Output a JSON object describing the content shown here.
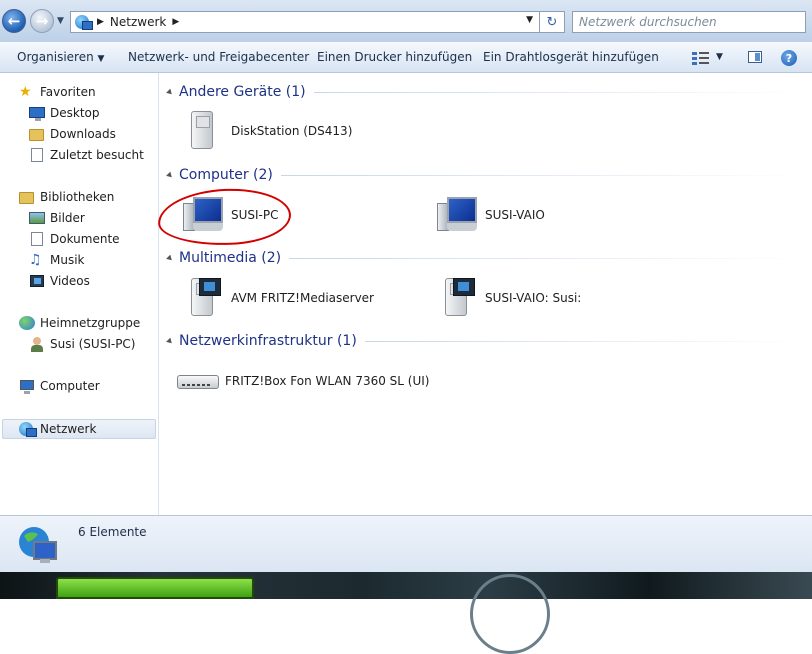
{
  "addressbar": {
    "location": "Netzwerk",
    "search_placeholder": "Netzwerk durchsuchen"
  },
  "toolbar": {
    "organize": "Organisieren",
    "network_center": "Netzwerk- und Freigabecenter",
    "add_printer": "Einen Drucker hinzufügen",
    "add_wireless": "Ein Drahtlosgerät hinzufügen"
  },
  "sidebar": {
    "favorites": "Favoriten",
    "desktop": "Desktop",
    "downloads": "Downloads",
    "recent": "Zuletzt besucht",
    "libraries": "Bibliotheken",
    "pictures": "Bilder",
    "documents": "Dokumente",
    "music": "Musik",
    "videos": "Videos",
    "homegroup": "Heimnetzgruppe",
    "homegroup_user": "Susi (SUSI-PC)",
    "computer": "Computer",
    "network": "Netzwerk"
  },
  "groups": {
    "other": {
      "title": "Andere Geräte (1)",
      "items": [
        "DiskStation (DS413)"
      ]
    },
    "computer": {
      "title": "Computer (2)",
      "items": [
        "SUSI-PC",
        "SUSI-VAIO"
      ]
    },
    "multimedia": {
      "title": "Multimedia (2)",
      "items": [
        "AVM FRITZ!Mediaserver",
        "SUSI-VAIO: Susi:"
      ]
    },
    "infra": {
      "title": "Netzwerkinfrastruktur (1)",
      "items": [
        "FRITZ!Box Fon WLAN 7360 SL (UI)"
      ]
    }
  },
  "status": {
    "count": "6 Elemente"
  },
  "colors": {
    "group_header": "#1e3287",
    "highlight_circle": "#d40000"
  }
}
